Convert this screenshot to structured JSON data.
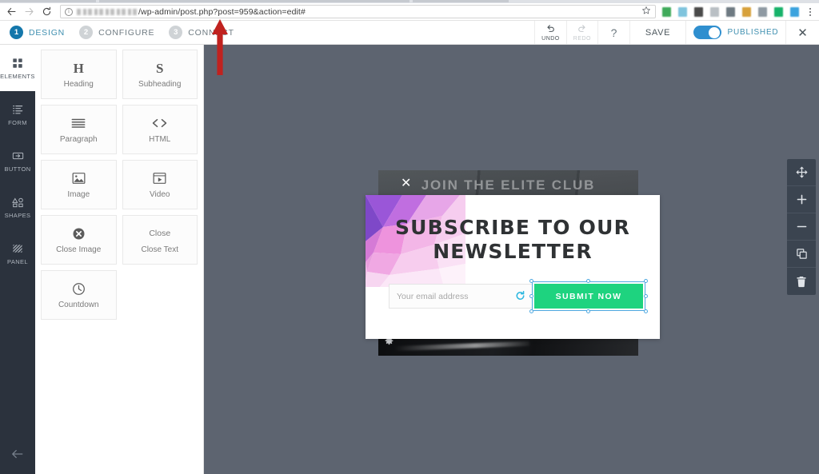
{
  "browser": {
    "nav": {
      "back": "back-arrow",
      "forward": "forward-arrow",
      "reload": "reload-arrow"
    },
    "url_info_glyph": "i",
    "url_prefix_redacted": true,
    "url": "/wp-admin/post.php?post=959&action=edit#",
    "bookmark_icon": "star-icon",
    "extensions": [
      {
        "name": "extension-1",
        "color": "#3faa5a"
      },
      {
        "name": "extension-2",
        "color": "#7fc4dd"
      },
      {
        "name": "extension-3",
        "color": "#4a4a4a"
      },
      {
        "name": "extension-4",
        "color": "#b9bfc4"
      },
      {
        "name": "extension-5",
        "color": "#6e7a82"
      },
      {
        "name": "extension-6",
        "color": "#d7a13a"
      },
      {
        "name": "extension-7",
        "color": "#8f9aa3"
      },
      {
        "name": "extension-8",
        "color": "#17b26a"
      },
      {
        "name": "extension-9",
        "color": "#3ba3de"
      }
    ],
    "menu_icon": "kebab-menu-icon"
  },
  "header": {
    "steps": [
      {
        "num": "1",
        "label": "DESIGN",
        "active": true
      },
      {
        "num": "2",
        "label": "CONFIGURE",
        "active": false
      },
      {
        "num": "3",
        "label": "CONNECT",
        "active": false
      }
    ],
    "undo": {
      "glyph": "↺",
      "label": "UNDO",
      "enabled": true
    },
    "redo": {
      "glyph": "↻",
      "label": "REDO",
      "enabled": false
    },
    "help": "?",
    "save_label": "SAVE",
    "publish": {
      "label": "PUBLISHED",
      "on": true,
      "color": "#2f8fcf"
    },
    "close": "✕"
  },
  "rail": {
    "items": [
      {
        "label": "ELEMENTS",
        "icon": "grid-icon",
        "active": true
      },
      {
        "label": "FORM",
        "icon": "form-icon",
        "active": false
      },
      {
        "label": "BUTTON",
        "icon": "button-icon",
        "active": false
      },
      {
        "label": "SHAPES",
        "icon": "shapes-icon",
        "active": false
      },
      {
        "label": "PANEL",
        "icon": "panel-icon",
        "active": false
      }
    ],
    "back": "back-arrow-icon"
  },
  "palette": {
    "cards": [
      {
        "label": "Heading",
        "icon": "letter-H",
        "glyph": "H"
      },
      {
        "label": "Subheading",
        "icon": "letter-S",
        "glyph": "S"
      },
      {
        "label": "Paragraph",
        "icon": "paragraph-icon",
        "glyph": ""
      },
      {
        "label": "HTML",
        "icon": "code-icon",
        "glyph": "<>"
      },
      {
        "label": "Image",
        "icon": "image-icon",
        "glyph": ""
      },
      {
        "label": "Video",
        "icon": "video-icon",
        "glyph": ""
      },
      {
        "label": "Close Image",
        "icon": "close-circle-icon",
        "glyph": ""
      },
      {
        "label": "Close Text",
        "icon": "close-text-label",
        "glyph": "Close"
      },
      {
        "label": "Countdown",
        "icon": "clock-icon",
        "glyph": ""
      }
    ]
  },
  "canvas": {
    "background_color": "#5d6470",
    "background_popup": {
      "title": "JOIN THE ELITE CLUB",
      "close_icon": "close-x-icon",
      "settings_icon": "gear-icon"
    },
    "popup": {
      "title": "SUBSCRIBE TO OUR NEWSLETTER",
      "email_placeholder": "Your email address",
      "email_value": "",
      "refresh_icon": "refresh-captcha-icon",
      "submit_label": "SUBMIT NOW",
      "submit_color": "#1ed37f",
      "selected_element": "submit-button",
      "selection_color": "#4ea8e0"
    },
    "float_tools": [
      {
        "name": "move-tool",
        "icon": "move-arrows-icon"
      },
      {
        "name": "zoom-in-tool",
        "icon": "plus-icon"
      },
      {
        "name": "zoom-out-tool",
        "icon": "minus-icon"
      },
      {
        "name": "duplicate-tool",
        "icon": "copy-icon"
      },
      {
        "name": "delete-tool",
        "icon": "trash-icon"
      }
    ]
  },
  "annotation": {
    "arrow": "red-up-arrow",
    "color": "#c0221f"
  }
}
